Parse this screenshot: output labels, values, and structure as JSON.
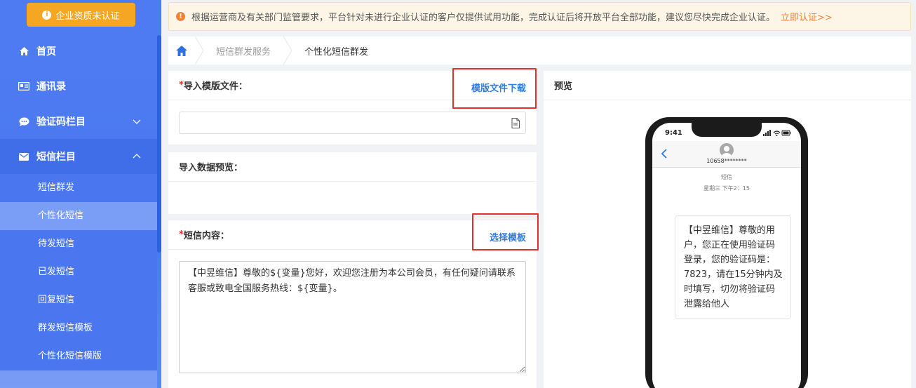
{
  "sidebar": {
    "cert_button": "企业资质未认证",
    "items": [
      {
        "label": "首页",
        "icon": "home-icon"
      },
      {
        "label": "通讯录",
        "icon": "contact-card-icon"
      },
      {
        "label": "验证码栏目",
        "icon": "chat-bubble-icon"
      },
      {
        "label": "短信栏目",
        "icon": "envelope-icon"
      }
    ],
    "sub_items": [
      "短信群发",
      "个性化短信",
      "待发短信",
      "已发短信",
      "回复短信",
      "群发短信模板",
      "个性化短信模版"
    ],
    "active_sub": "个性化短信"
  },
  "notice": {
    "text": "根据运营商及有关部门监管要求，平台针对未进行企业认证的客户仅提供试用功能，完成认证后将开放平台全部功能，建议您尽快完成企业认证。",
    "link": "立即认证>>"
  },
  "breadcrumb": {
    "items": [
      "短信群发服务",
      "个性化短信群发"
    ]
  },
  "import": {
    "required_mark": "*",
    "label": "导入模版文件：",
    "download_link": "模版文件下载"
  },
  "preview_data": {
    "label": "导入数据预览："
  },
  "content": {
    "required_mark": "*",
    "label": "短信内容：",
    "select_link": "选择模板",
    "text": "【中昱维信】尊敬的${变量}您好，欢迎您注册为本公司会员，有任何疑问请联系客服或致电全国服务热线：${变量}。"
  },
  "preview": {
    "title": "预览",
    "phone_time": "9:41",
    "sender": "10658********",
    "sms_label": "短信",
    "sms_time": "星期三 下午2：15",
    "message": "【中昱维信】尊敬的用户，您正在使用验证码登录，您的验证码是：7823，请在15分钟内及时填写，切勿将验证码泄露给他人"
  },
  "colors": {
    "sidebar": "#4a78f0",
    "accent_blue": "#2f7ce0",
    "warning_orange": "#f0833a",
    "cert_orange": "#f5a623",
    "highlight_red": "#e0322b"
  }
}
